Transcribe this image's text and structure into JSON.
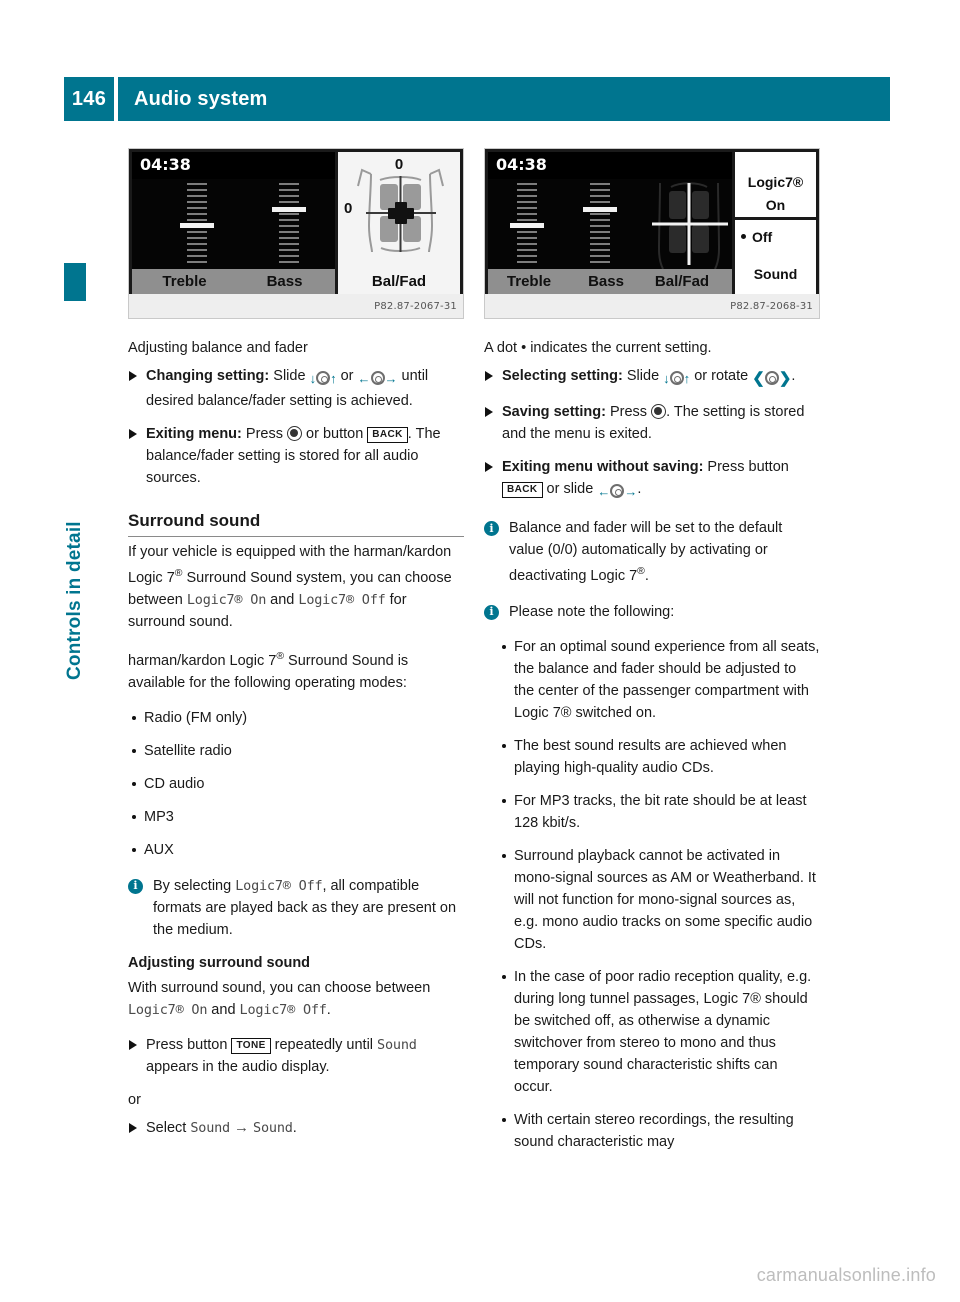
{
  "header": {
    "page_number": "146",
    "title": "Audio system",
    "accent_color": "#00758f"
  },
  "sidebar": {
    "chapter_label": "Controls in detail"
  },
  "figures": [
    {
      "name": "balance-fader-screen",
      "clock": "04:38",
      "labels": [
        "Treble",
        "Bass"
      ],
      "panel_label": "Bal/Fad",
      "balance_value": "0",
      "fader_value": "0",
      "caption": "P82.87-2067-31"
    },
    {
      "name": "logic7-menu-screen",
      "clock": "04:38",
      "labels": [
        "Treble",
        "Bass",
        "Bal/Fad"
      ],
      "popup": {
        "heading": "Logic7®",
        "items": [
          "On",
          "Off",
          "Sound"
        ],
        "selected": "Off"
      },
      "caption": "P82.87-2068-31"
    }
  ],
  "left_column": {
    "intro": "Adjusting balance and fader",
    "steps": [
      {
        "bold": "Changing setting:",
        "text_a": " Slide ",
        "icon_a": "slide-vertical-icon",
        "text_b": " or ",
        "icon_b": "slide-horizontal-icon",
        "text_c": " until desired balance/fader setting is achieved."
      },
      {
        "bold": "Exiting menu:",
        "text_a": " Press ",
        "icon_a": "press-controller-icon",
        "text_b": " or button ",
        "button": "BACK",
        "text_c": ". The balance/fader setting is stored for all audio sources."
      }
    ],
    "section_title": "Surround sound",
    "para1_a": "If your vehicle is equipped with the harman/kardon Logic 7",
    "para1_b": " Surround Sound system, you can choose between ",
    "para1_mono1": "Logic7® On",
    "para1_c": " and ",
    "para1_mono2": "Logic7® Off",
    "para1_d": " for surround sound.",
    "para2_a": "harman/kardon Logic 7",
    "para2_b": " Surround Sound is available for the following operating modes:",
    "modes": [
      "Radio (FM only)",
      "Satellite radio",
      "CD audio",
      "MP3",
      "AUX"
    ],
    "note_a": "By selecting ",
    "note_mono": "Logic7® Off",
    "note_b": ", all compatible formats are played back as they are present on the medium.",
    "sub_title": "Adjusting surround sound",
    "para3_a": "With surround sound, you can choose between ",
    "para3_mono1": "Logic7® On",
    "para3_b": " and ",
    "para3_mono2": "Logic7® Off",
    "para3_c": ".",
    "step3_a": "Press button ",
    "step3_button": "TONE",
    "step3_b": " repeatedly until ",
    "step3_mono": "Sound",
    "step3_c": " appears in the audio display.",
    "or_label": "or",
    "step4_a": "Select ",
    "step4_mono1": "Sound",
    "step4_arrow": "→",
    "step4_mono2": "Sound",
    "step4_b": "."
  },
  "right_column": {
    "intro_a": "A dot ",
    "intro_dot": "•",
    "intro_b": " indicates the current setting.",
    "steps": [
      {
        "bold": "Selecting setting:",
        "text_a": " Slide ",
        "icon_a": "slide-vertical-icon",
        "text_b": " or rotate ",
        "icon_b": "rotate-controller-icon",
        "text_c": "."
      },
      {
        "bold": "Saving setting:",
        "text_a": " Press ",
        "icon_a": "press-controller-icon",
        "text_b": ". The setting is stored and the menu is exited."
      },
      {
        "bold": "Exiting menu without saving:",
        "text_a": " Press button ",
        "button": "BACK",
        "text_b": " or slide ",
        "icon_a": "slide-horizontal-icon",
        "text_c": "."
      }
    ],
    "note1_a": "Balance and fader will be set to the default value (0/0) automatically by activating or deactivating Logic 7",
    "note1_b": ".",
    "note2": "Please note the following:",
    "bullets": [
      "For an optimal sound experience from all seats, the balance and fader should be adjusted to the center of the passenger compartment with Logic 7® switched on.",
      "The best sound results are achieved when playing high-quality audio CDs.",
      "For MP3 tracks, the bit rate should be at least 128 kbit/s.",
      "Surround playback cannot be activated in mono-signal sources as AM or Weatherband. It will not function for mono-signal sources as, e.g. mono audio tracks on some specific audio CDs.",
      "In the case of poor radio reception quality, e.g. during long tunnel passages, Logic 7® should be switched off, as otherwise a dynamic switchover from stereo to mono and thus temporary sound characteristic shifts can occur.",
      "With certain stereo recordings, the resulting sound characteristic may"
    ]
  },
  "footer": {
    "watermark": "carmanualsonline.info"
  }
}
